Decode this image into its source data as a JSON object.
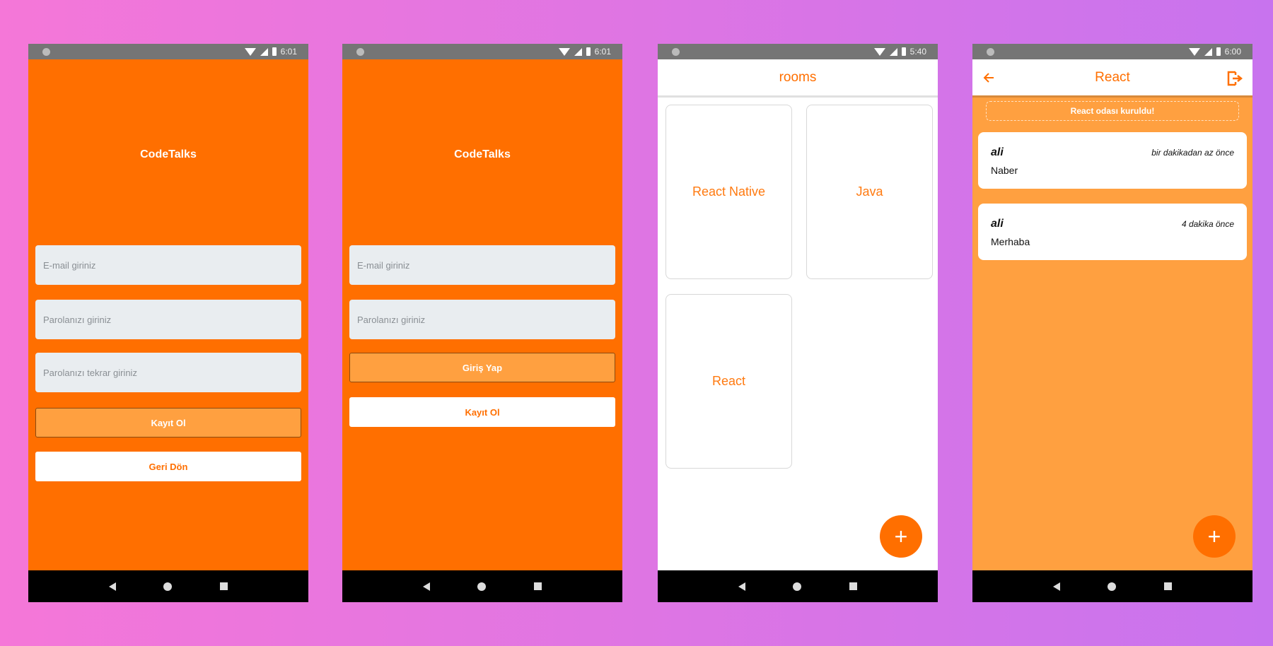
{
  "screens": [
    {
      "time": "6:01",
      "app_title": "CodeTalks",
      "email_placeholder": "E-mail giriniz",
      "password_placeholder": "Parolanızı giriniz",
      "password_repeat_placeholder": "Parolanızı tekrar giriniz",
      "register_label": "Kayıt Ol",
      "back_label": "Geri Dön"
    },
    {
      "time": "6:01",
      "app_title": "CodeTalks",
      "email_placeholder": "E-mail giriniz",
      "password_placeholder": "Parolanızı giriniz",
      "login_label": "Giriş Yap",
      "register_label": "Kayıt Ol"
    },
    {
      "time": "5:40",
      "header_title": "rooms",
      "rooms": [
        "React Native",
        "Java",
        "React"
      ],
      "fab_label": "+"
    },
    {
      "time": "6:00",
      "header_title": "React",
      "notice": "React odası kuruldu!",
      "messages": [
        {
          "user": "ali",
          "time": "bir dakikadan az önce",
          "text": "Naber"
        },
        {
          "user": "ali",
          "time": "4 dakika önce",
          "text": "Merhaba"
        }
      ],
      "fab_label": "+"
    }
  ],
  "colors": {
    "primary": "#ff6f00",
    "light": "#ffa040"
  }
}
